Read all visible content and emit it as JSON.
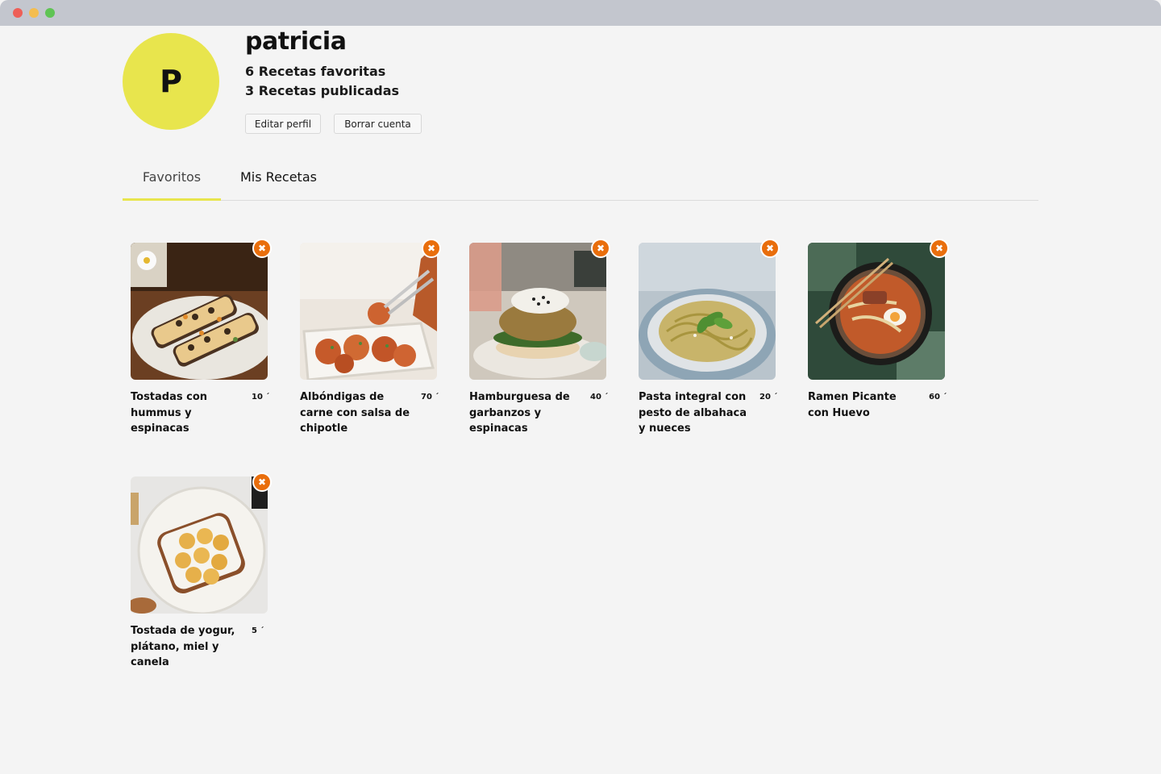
{
  "window": {
    "controls": [
      "close",
      "minimize",
      "maximize"
    ]
  },
  "profile": {
    "initial": "P",
    "username": "patricia",
    "favorites_stat": "6 Recetas favoritas",
    "published_stat": "3 Recetas publicadas",
    "edit_label": "Editar perfil",
    "delete_label": "Borrar cuenta",
    "avatar_color": "#e8e54d"
  },
  "tabs": [
    {
      "label": "Favoritos",
      "active": true
    },
    {
      "label": "Mis Recetas",
      "active": false
    }
  ],
  "accent": {
    "remove_button": "#e96e0c",
    "tab_underline": "#e8e54d"
  },
  "recipes": [
    {
      "title": "Tostadas con hummus y espinacas",
      "time": "10 ´",
      "remove_icon": "close-icon"
    },
    {
      "title": "Albóndigas de carne con salsa de chipotle",
      "time": "70 ´",
      "remove_icon": "close-icon"
    },
    {
      "title": "Hamburguesa de garbanzos y espinacas",
      "time": "40 ´",
      "remove_icon": "close-icon"
    },
    {
      "title": "Pasta integral con pesto de albahaca y nueces",
      "time": "20 ´",
      "remove_icon": "close-icon"
    },
    {
      "title": "Ramen Picante con Huevo",
      "time": "60 ´",
      "remove_icon": "close-icon"
    },
    {
      "title": "Tostada de yogur, plátano, miel y canela",
      "time": "5 ´",
      "remove_icon": "close-icon"
    }
  ]
}
